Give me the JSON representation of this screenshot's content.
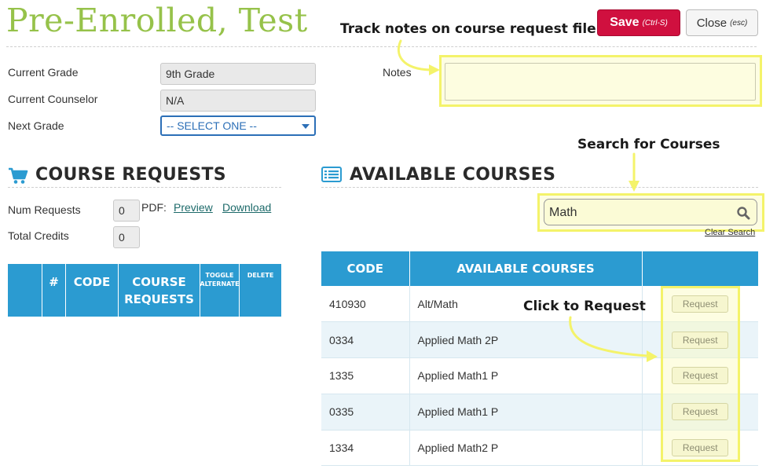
{
  "header": {
    "student_name": "Pre-Enrolled, Test",
    "save_label": "Save",
    "save_hint": "(Ctrl-S)",
    "close_label": "Close",
    "close_hint": "(esc)"
  },
  "annotations": {
    "notes_tip": "Track notes on course request file",
    "search_tip": "Search for Courses",
    "request_tip": "Click to Request"
  },
  "student_info": {
    "current_grade_label": "Current Grade",
    "current_grade_value": "9th Grade",
    "current_counselor_label": "Current Counselor",
    "current_counselor_value": "N/A",
    "next_grade_label": "Next Grade",
    "next_grade_selected": "-- SELECT ONE --",
    "notes_label": "Notes",
    "notes_value": ""
  },
  "course_requests": {
    "title": "COURSE REQUESTS",
    "num_requests_label": "Num Requests",
    "num_requests_value": "0",
    "total_credits_label": "Total Credits",
    "total_credits_value": "0",
    "pdf_label": "PDF:",
    "preview_link": "Preview",
    "download_link": "Download",
    "columns": {
      "num": "#",
      "code": "CODE",
      "course_line1": "COURSE",
      "course_line2": "REQUESTS",
      "toggle_line1": "TOGGLE",
      "toggle_line2": "ALTERNATE",
      "delete": "DELETE"
    }
  },
  "available_courses": {
    "title": "AVAILABLE COURSES",
    "search_value": "Math",
    "clear_search": "Clear Search",
    "columns": {
      "code": "CODE",
      "name": "AVAILABLE COURSES"
    },
    "rows": [
      {
        "code": "410930",
        "name": "Alt/Math",
        "action": "Request"
      },
      {
        "code": "0334",
        "name": "Applied Math 2P",
        "action": "Request"
      },
      {
        "code": "1335",
        "name": "Applied Math1 P",
        "action": "Request"
      },
      {
        "code": "0335",
        "name": "Applied Math1 P",
        "action": "Request"
      },
      {
        "code": "1334",
        "name": "Applied Math2 P",
        "action": "Request"
      }
    ]
  },
  "colors": {
    "title_green": "#96c24a",
    "save_red": "#d0103f",
    "table_blue": "#2b9bd1",
    "highlight_yellow": "#f4f36a"
  },
  "icons": {
    "cart": "shopping-cart-icon",
    "list": "list-icon",
    "search": "search-icon"
  }
}
